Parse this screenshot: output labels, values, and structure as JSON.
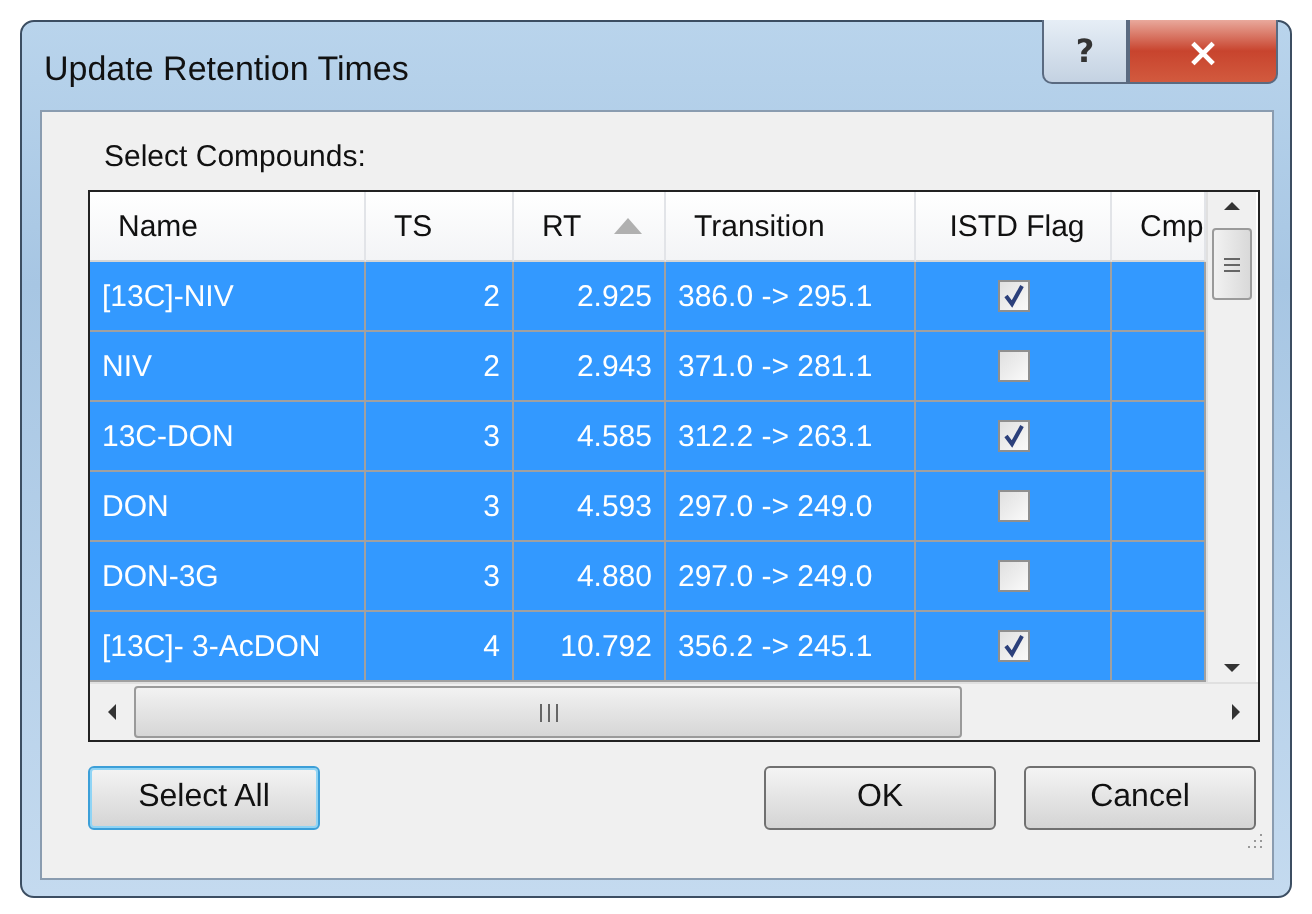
{
  "window": {
    "title": "Update Retention Times",
    "title_buttons": [
      "?",
      "×"
    ]
  },
  "label": "Select Compounds:",
  "table": {
    "columns": [
      {
        "label": "Name",
        "sorted": false
      },
      {
        "label": "TS",
        "sorted": false
      },
      {
        "label": "RT",
        "sorted": true
      },
      {
        "label": "Transition",
        "sorted": false
      },
      {
        "label": "ISTD Flag",
        "sorted": false
      },
      {
        "label": "Cmp",
        "sorted": false
      }
    ],
    "rows": [
      {
        "selected": true,
        "name": "[13C]-NIV",
        "ts": "2",
        "rt": "2.925",
        "transition": "386.0 -> 295.1",
        "istd": true
      },
      {
        "selected": true,
        "name": "NIV",
        "ts": "2",
        "rt": "2.943",
        "transition": "371.0 -> 281.1",
        "istd": false
      },
      {
        "selected": true,
        "name": "13C-DON",
        "ts": "3",
        "rt": "4.585",
        "transition": "312.2 -> 263.1",
        "istd": true
      },
      {
        "selected": true,
        "name": "DON",
        "ts": "3",
        "rt": "4.593",
        "transition": "297.0 -> 249.0",
        "istd": false
      },
      {
        "selected": true,
        "name": "DON-3G",
        "ts": "3",
        "rt": "4.880",
        "transition": "297.0 -> 249.0",
        "istd": false
      },
      {
        "selected": true,
        "name": "[13C]- 3-AcDON",
        "ts": "4",
        "rt": "10.792",
        "transition": "356.2 -> 245.1",
        "istd": true
      }
    ]
  },
  "buttons": [
    {
      "label": "Select All",
      "focused": true
    },
    {
      "label": "OK",
      "focused": false
    },
    {
      "label": "Cancel",
      "focused": false
    }
  ]
}
